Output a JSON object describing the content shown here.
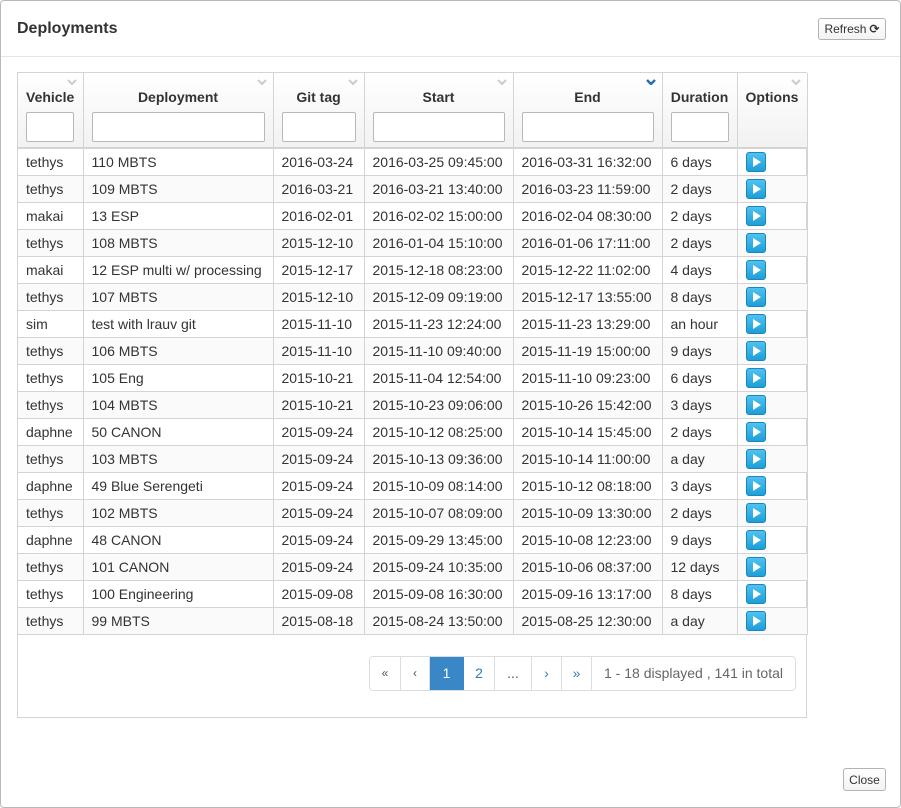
{
  "modal": {
    "title": "Deployments",
    "refresh_label": "Refresh",
    "refresh_icon": "⟳",
    "close_label": "Close"
  },
  "columns": [
    {
      "label": "Vehicle"
    },
    {
      "label": "Deployment"
    },
    {
      "label": "Git tag"
    },
    {
      "label": "Start"
    },
    {
      "label": "End"
    },
    {
      "label": "Duration"
    },
    {
      "label": "Options"
    }
  ],
  "rows": [
    [
      "tethys",
      "110 MBTS",
      "2016-03-24",
      "2016-03-25 09:45:00",
      "2016-03-31 16:32:00",
      "6 days"
    ],
    [
      "tethys",
      "109 MBTS",
      "2016-03-21",
      "2016-03-21 13:40:00",
      "2016-03-23 11:59:00",
      "2 days"
    ],
    [
      "makai",
      "13 ESP",
      "2016-02-01",
      "2016-02-02 15:00:00",
      "2016-02-04 08:30:00",
      "2 days"
    ],
    [
      "tethys",
      "108 MBTS",
      "2015-12-10",
      "2016-01-04 15:10:00",
      "2016-01-06 17:11:00",
      "2 days"
    ],
    [
      "makai",
      "12 ESP multi w/ processing",
      "2015-12-17",
      "2015-12-18 08:23:00",
      "2015-12-22 11:02:00",
      "4 days"
    ],
    [
      "tethys",
      "107 MBTS",
      "2015-12-10",
      "2015-12-09 09:19:00",
      "2015-12-17 13:55:00",
      "8 days"
    ],
    [
      "sim",
      "test with lrauv git",
      "2015-11-10",
      "2015-11-23 12:24:00",
      "2015-11-23 13:29:00",
      "an hour"
    ],
    [
      "tethys",
      "106 MBTS",
      "2015-11-10",
      "2015-11-10 09:40:00",
      "2015-11-19 15:00:00",
      "9 days"
    ],
    [
      "tethys",
      "105 Eng",
      "2015-10-21",
      "2015-11-04 12:54:00",
      "2015-11-10 09:23:00",
      "6 days"
    ],
    [
      "tethys",
      "104 MBTS",
      "2015-10-21",
      "2015-10-23 09:06:00",
      "2015-10-26 15:42:00",
      "3 days"
    ],
    [
      "daphne",
      "50 CANON",
      "2015-09-24",
      "2015-10-12 08:25:00",
      "2015-10-14 15:45:00",
      "2 days"
    ],
    [
      "tethys",
      "103 MBTS",
      "2015-09-24",
      "2015-10-13 09:36:00",
      "2015-10-14 11:00:00",
      "a day"
    ],
    [
      "daphne",
      "49 Blue Serengeti",
      "2015-09-24",
      "2015-10-09 08:14:00",
      "2015-10-12 08:18:00",
      "3 days"
    ],
    [
      "tethys",
      "102 MBTS",
      "2015-09-24",
      "2015-10-07 08:09:00",
      "2015-10-09 13:30:00",
      "2 days"
    ],
    [
      "daphne",
      "48 CANON",
      "2015-09-24",
      "2015-09-29 13:45:00",
      "2015-10-08 12:23:00",
      "9 days"
    ],
    [
      "tethys",
      "101 CANON",
      "2015-09-24",
      "2015-09-24 10:35:00",
      "2015-10-06 08:37:00",
      "12 days"
    ],
    [
      "tethys",
      "100 Engineering",
      "2015-09-08",
      "2015-09-08 16:30:00",
      "2015-09-16 13:17:00",
      "8 days"
    ],
    [
      "tethys",
      "99 MBTS",
      "2015-08-18",
      "2015-08-24 13:50:00",
      "2015-08-25 12:30:00",
      "a day"
    ]
  ],
  "pagination": {
    "first": "«",
    "prev": "‹",
    "pages": [
      "1",
      "2",
      "..."
    ],
    "active_page": "1",
    "next": "›",
    "last": "»",
    "info": "1 - 18 displayed , 141 in total"
  },
  "colors": {
    "sort_default": "#cccccc",
    "sort_active": "#2a6fa8",
    "play_button": "#29aee6",
    "active_page": "#3a87c8"
  },
  "sort": {
    "active_column": "End",
    "direction": "desc"
  }
}
